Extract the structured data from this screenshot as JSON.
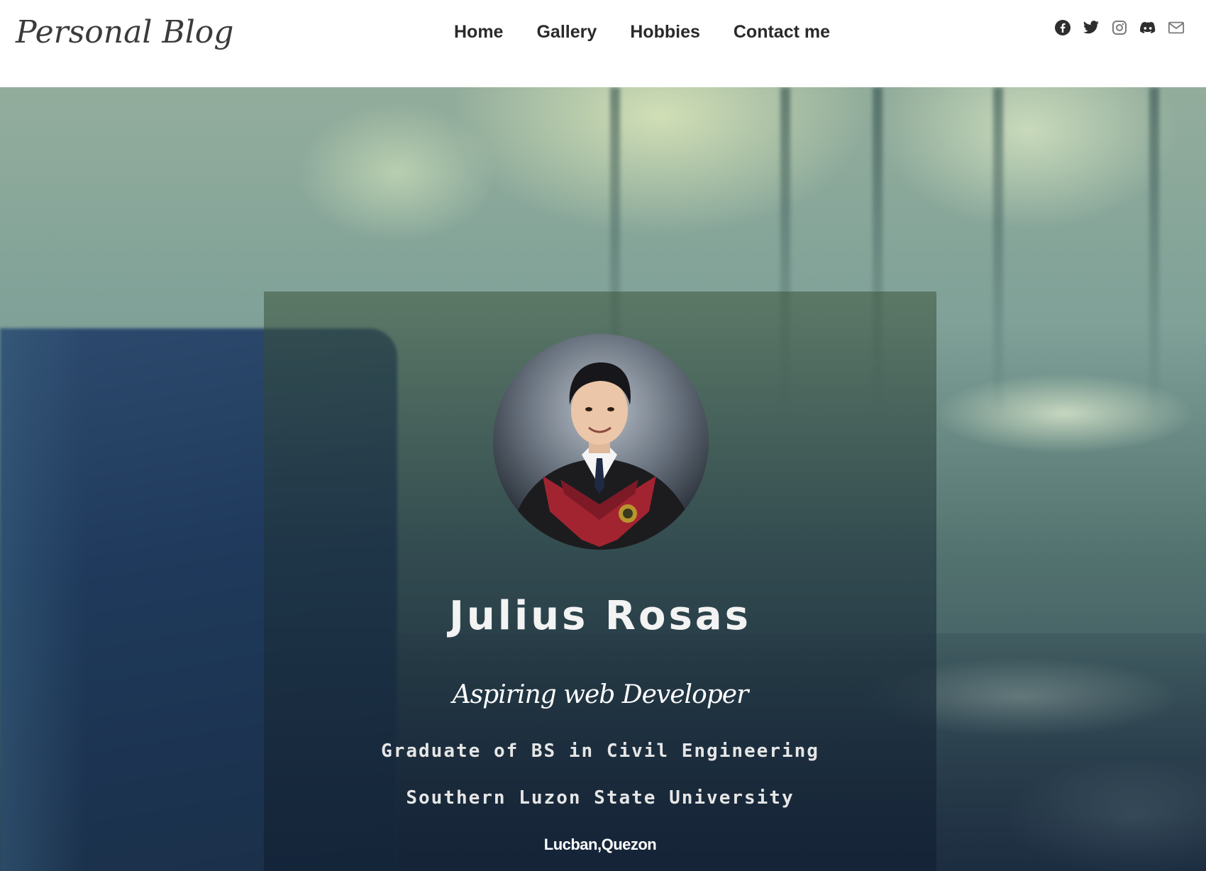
{
  "header": {
    "brand": "Personal Blog",
    "nav": [
      {
        "label": "Home"
      },
      {
        "label": "Gallery"
      },
      {
        "label": "Hobbies"
      },
      {
        "label": "Contact me"
      }
    ],
    "social_icons": [
      "facebook-icon",
      "twitter-icon",
      "instagram-icon",
      "discord-icon",
      "mail-icon"
    ]
  },
  "profile": {
    "name": "Julius Rosas",
    "tagline": "Aspiring web Developer",
    "degree": "Graduate of BS in Civil Engineering",
    "school": "Southern Luzon State University",
    "location": "Lucban,Quezon"
  },
  "colors": {
    "header_bg": "#ffffff",
    "nav_text": "#2a2a2a",
    "card_text": "#f3f3f3",
    "laptop_blue": "#1f3a5c"
  }
}
